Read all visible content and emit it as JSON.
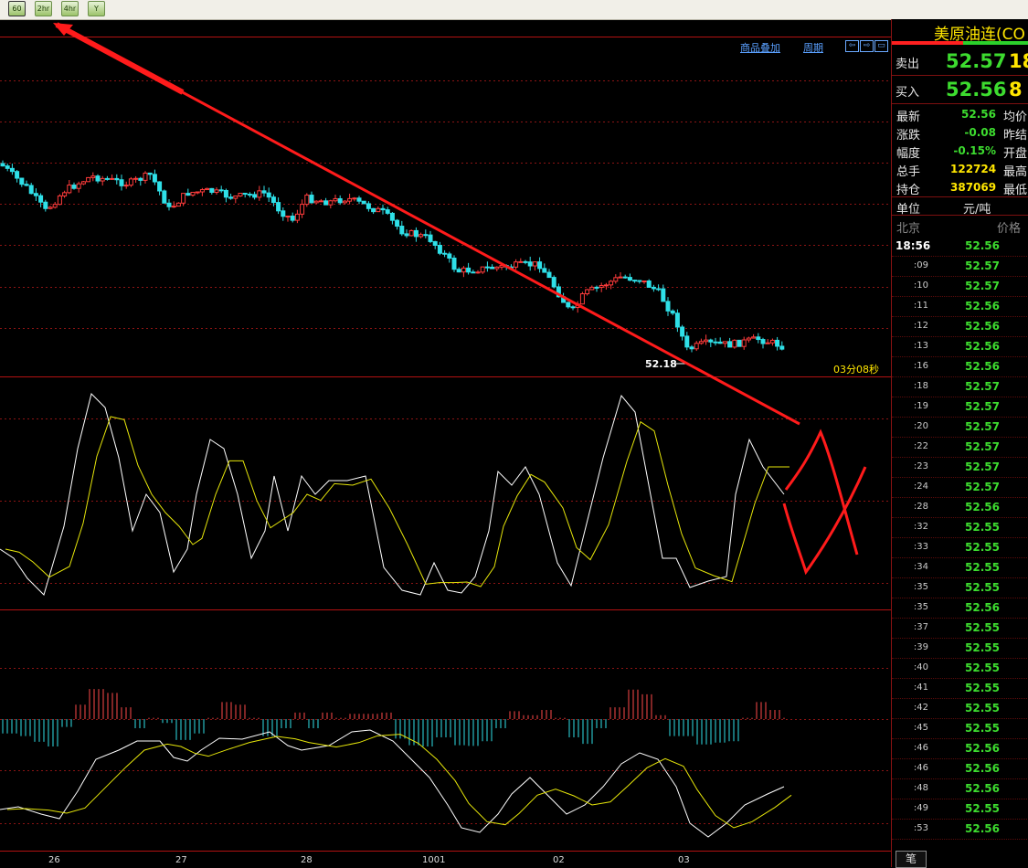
{
  "toolbar": {
    "buttons": [
      "60",
      "2hr",
      "4hr",
      "Y"
    ]
  },
  "chart": {
    "links": [
      "商品叠加",
      "周期"
    ],
    "nav_buttons": [
      "⇦",
      "⇨",
      "▭"
    ],
    "price_marker": "52.18",
    "timer": "03分08秒",
    "x_labels": [
      "26",
      "27",
      "28",
      "1001",
      "02",
      "03"
    ]
  },
  "quote": {
    "name": "美原油连(CO",
    "sell_label": "卖出",
    "sell_price": "52.57",
    "sell_vol": "18",
    "buy_label": "买入",
    "buy_price": "52.56",
    "buy_vol": "8",
    "stats": [
      {
        "label": "最新",
        "value": "52.56",
        "right": "均价"
      },
      {
        "label": "涨跌",
        "value": "-0.08",
        "right": "昨结"
      },
      {
        "label": "幅度",
        "value": "-0.15%",
        "right": "开盘"
      },
      {
        "label": "总手",
        "value": "122724",
        "right": "最高"
      },
      {
        "label": "持仓",
        "value": "387069",
        "right": "最低"
      }
    ],
    "unit_label": "单位",
    "unit_value": "元/吨",
    "tick_header_left": "北京",
    "tick_header_right": "价格",
    "ticks": [
      {
        "t": "18:56",
        "p": "52.56"
      },
      {
        "t": ":09",
        "p": "52.57"
      },
      {
        "t": ":10",
        "p": "52.57"
      },
      {
        "t": ":11",
        "p": "52.56"
      },
      {
        "t": ":12",
        "p": "52.56"
      },
      {
        "t": ":13",
        "p": "52.56"
      },
      {
        "t": ":16",
        "p": "52.56"
      },
      {
        "t": ":18",
        "p": "52.57"
      },
      {
        "t": ":19",
        "p": "52.57"
      },
      {
        "t": ":20",
        "p": "52.57"
      },
      {
        "t": ":22",
        "p": "52.57"
      },
      {
        "t": ":23",
        "p": "52.57"
      },
      {
        "t": ":24",
        "p": "52.57"
      },
      {
        "t": ":28",
        "p": "52.56"
      },
      {
        "t": ":32",
        "p": "52.55"
      },
      {
        "t": ":33",
        "p": "52.55"
      },
      {
        "t": ":34",
        "p": "52.55"
      },
      {
        "t": ":35",
        "p": "52.55"
      },
      {
        "t": ":35",
        "p": "52.56"
      },
      {
        "t": ":37",
        "p": "52.55"
      },
      {
        "t": ":39",
        "p": "52.55"
      },
      {
        "t": ":40",
        "p": "52.55"
      },
      {
        "t": ":41",
        "p": "52.55"
      },
      {
        "t": ":42",
        "p": "52.55"
      },
      {
        "t": ":45",
        "p": "52.55"
      },
      {
        "t": ":46",
        "p": "52.56"
      },
      {
        "t": ":46",
        "p": "52.56"
      },
      {
        "t": ":48",
        "p": "52.56"
      },
      {
        "t": ":49",
        "p": "52.55"
      },
      {
        "t": ":53",
        "p": "52.56"
      }
    ],
    "bottom_tab": "笔"
  }
}
